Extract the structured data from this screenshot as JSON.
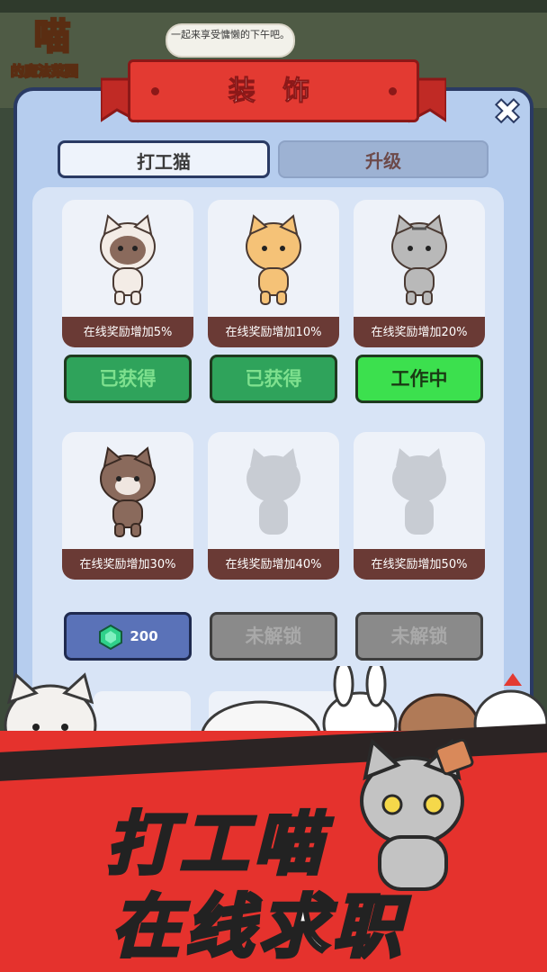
{
  "logo": {
    "main": "喵",
    "sub": "的魔法菜园"
  },
  "speech_bubble": {
    "text": "一起来享受慵懒的下午吧。"
  },
  "dialog": {
    "title": "装 饰",
    "close_label": "✖",
    "tabs": [
      {
        "label": "打工猫",
        "active": true
      },
      {
        "label": "升级",
        "active": false
      }
    ]
  },
  "cards": [
    {
      "bonus": "在线奖励增加5%",
      "button": "已获得",
      "state": "owned",
      "cat": "white-hood"
    },
    {
      "bonus": "在线奖励增加10%",
      "button": "已获得",
      "state": "owned",
      "cat": "orange"
    },
    {
      "bonus": "在线奖励增加20%",
      "button": "工作中",
      "state": "working",
      "cat": "gray-tabby"
    },
    {
      "bonus": "在线奖励增加30%",
      "button": "200",
      "state": "buy",
      "cat": "brown"
    },
    {
      "bonus": "在线奖励增加40%",
      "button": "未解锁",
      "state": "locked",
      "cat": "silhouette"
    },
    {
      "bonus": "在线奖励增加50%",
      "button": "未解锁",
      "state": "locked",
      "cat": "silhouette"
    }
  ],
  "banner": {
    "line1": "打工喵",
    "line2": "在线求职"
  },
  "colors": {
    "ribbon": "#e33a32",
    "owned": "#2fa35b",
    "working": "#3ce04e",
    "panel": "#b6cdee",
    "label": "#6a3a35"
  }
}
